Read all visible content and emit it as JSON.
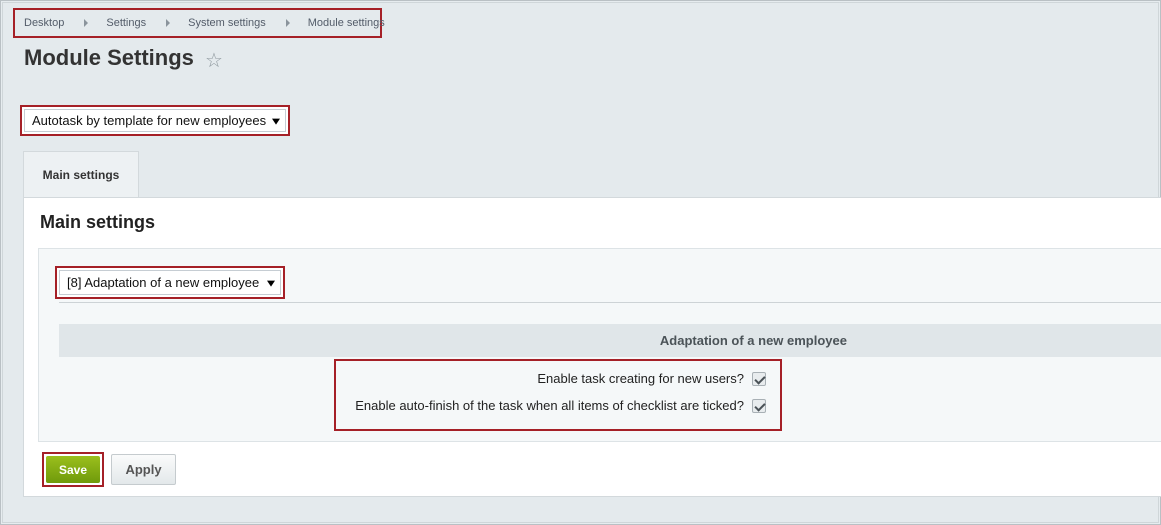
{
  "breadcrumb": [
    "Desktop",
    "Settings",
    "System settings",
    "Module settings"
  ],
  "page_title": "Module Settings",
  "module_select": {
    "value": "Autotask by template for new employees"
  },
  "tabs": [
    {
      "label": "Main settings"
    }
  ],
  "panel": {
    "title": "Main settings",
    "template_select": {
      "value": "[8] Adaptation of a new employee"
    },
    "section_header": "Adaptation of a new employee",
    "options": [
      {
        "label": "Enable task creating for new users?",
        "checked": true
      },
      {
        "label": "Enable auto-finish of the task when all items of checklist are ticked?",
        "checked": true
      }
    ]
  },
  "buttons": {
    "save": "Save",
    "apply": "Apply"
  },
  "colors": {
    "highlight": "#a52027",
    "save_green": "#7fa812"
  }
}
